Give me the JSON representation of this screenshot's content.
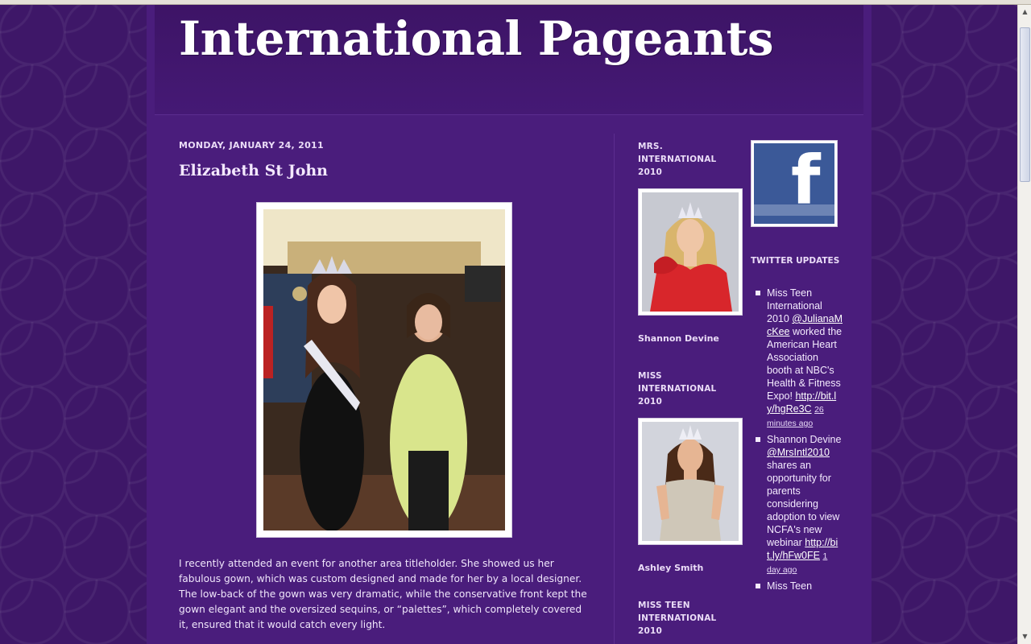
{
  "blog": {
    "title": "International Pageants"
  },
  "post": {
    "date": "MONDAY, JANUARY 24, 2011",
    "title": "Elizabeth St John",
    "body": "I recently attended an event for another area titleholder.  She showed us her fabulous gown, which was custom designed and made for her by a local designer. The low-back of the gown was very dramatic, while the conservative front kept the gown elegant and the oversized sequins, or “palettes”, which completely covered it, ensured that it would catch every light."
  },
  "sidebar1": [
    {
      "heading": "MRS. INTERNATIONAL 2010",
      "caption": "Shannon Devine",
      "dress_color": "#d8262b"
    },
    {
      "heading": "MISS INTERNATIONAL 2010",
      "caption": "Ashley Smith",
      "dress_color": "#c9c2b6"
    },
    {
      "heading": "MISS TEEN INTERNATIONAL 2010",
      "caption": "",
      "dress_color": ""
    }
  ],
  "sidebar2": {
    "facebook_icon": "facebook-f-icon",
    "twitter_heading": "TWITTER UPDATES",
    "tweets": [
      {
        "text": "Miss Teen International 2010 ",
        "mention": "@JulianaMcKee",
        "text2": " worked the American Heart Association booth at NBC's Health & Fitness Expo! ",
        "link": "http://bit.ly/hgRe3C",
        "time": "26 minutes ago"
      },
      {
        "text": "Shannon Devine ",
        "mention": "@MrsIntl2010",
        "text2": " shares an opportunity for parents considering adoption to view NCFA's new webinar ",
        "link": "http://bit.ly/hFw0FE",
        "time": "1 day ago"
      },
      {
        "text": "Miss Teen",
        "mention": "",
        "text2": "",
        "link": "",
        "time": ""
      }
    ]
  },
  "colors": {
    "background": "#3e1768",
    "panel": "#4a1d7c",
    "header": "#3d1466",
    "facebook": "#3b5998"
  }
}
